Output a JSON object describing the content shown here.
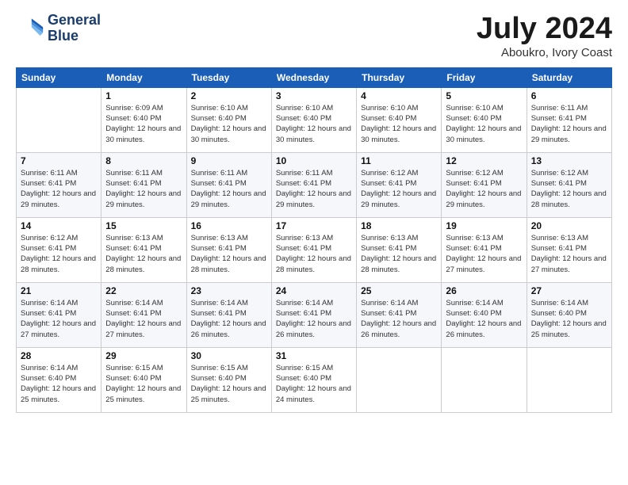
{
  "logo": {
    "line1": "General",
    "line2": "Blue"
  },
  "title": "July 2024",
  "subtitle": "Aboukro, Ivory Coast",
  "header": {
    "days": [
      "Sunday",
      "Monday",
      "Tuesday",
      "Wednesday",
      "Thursday",
      "Friday",
      "Saturday"
    ]
  },
  "weeks": [
    [
      {
        "num": "",
        "sunrise": "",
        "sunset": "",
        "daylight": ""
      },
      {
        "num": "1",
        "sunrise": "Sunrise: 6:09 AM",
        "sunset": "Sunset: 6:40 PM",
        "daylight": "Daylight: 12 hours and 30 minutes."
      },
      {
        "num": "2",
        "sunrise": "Sunrise: 6:10 AM",
        "sunset": "Sunset: 6:40 PM",
        "daylight": "Daylight: 12 hours and 30 minutes."
      },
      {
        "num": "3",
        "sunrise": "Sunrise: 6:10 AM",
        "sunset": "Sunset: 6:40 PM",
        "daylight": "Daylight: 12 hours and 30 minutes."
      },
      {
        "num": "4",
        "sunrise": "Sunrise: 6:10 AM",
        "sunset": "Sunset: 6:40 PM",
        "daylight": "Daylight: 12 hours and 30 minutes."
      },
      {
        "num": "5",
        "sunrise": "Sunrise: 6:10 AM",
        "sunset": "Sunset: 6:40 PM",
        "daylight": "Daylight: 12 hours and 30 minutes."
      },
      {
        "num": "6",
        "sunrise": "Sunrise: 6:11 AM",
        "sunset": "Sunset: 6:41 PM",
        "daylight": "Daylight: 12 hours and 29 minutes."
      }
    ],
    [
      {
        "num": "7",
        "sunrise": "Sunrise: 6:11 AM",
        "sunset": "Sunset: 6:41 PM",
        "daylight": "Daylight: 12 hours and 29 minutes."
      },
      {
        "num": "8",
        "sunrise": "Sunrise: 6:11 AM",
        "sunset": "Sunset: 6:41 PM",
        "daylight": "Daylight: 12 hours and 29 minutes."
      },
      {
        "num": "9",
        "sunrise": "Sunrise: 6:11 AM",
        "sunset": "Sunset: 6:41 PM",
        "daylight": "Daylight: 12 hours and 29 minutes."
      },
      {
        "num": "10",
        "sunrise": "Sunrise: 6:11 AM",
        "sunset": "Sunset: 6:41 PM",
        "daylight": "Daylight: 12 hours and 29 minutes."
      },
      {
        "num": "11",
        "sunrise": "Sunrise: 6:12 AM",
        "sunset": "Sunset: 6:41 PM",
        "daylight": "Daylight: 12 hours and 29 minutes."
      },
      {
        "num": "12",
        "sunrise": "Sunrise: 6:12 AM",
        "sunset": "Sunset: 6:41 PM",
        "daylight": "Daylight: 12 hours and 29 minutes."
      },
      {
        "num": "13",
        "sunrise": "Sunrise: 6:12 AM",
        "sunset": "Sunset: 6:41 PM",
        "daylight": "Daylight: 12 hours and 28 minutes."
      }
    ],
    [
      {
        "num": "14",
        "sunrise": "Sunrise: 6:12 AM",
        "sunset": "Sunset: 6:41 PM",
        "daylight": "Daylight: 12 hours and 28 minutes."
      },
      {
        "num": "15",
        "sunrise": "Sunrise: 6:13 AM",
        "sunset": "Sunset: 6:41 PM",
        "daylight": "Daylight: 12 hours and 28 minutes."
      },
      {
        "num": "16",
        "sunrise": "Sunrise: 6:13 AM",
        "sunset": "Sunset: 6:41 PM",
        "daylight": "Daylight: 12 hours and 28 minutes."
      },
      {
        "num": "17",
        "sunrise": "Sunrise: 6:13 AM",
        "sunset": "Sunset: 6:41 PM",
        "daylight": "Daylight: 12 hours and 28 minutes."
      },
      {
        "num": "18",
        "sunrise": "Sunrise: 6:13 AM",
        "sunset": "Sunset: 6:41 PM",
        "daylight": "Daylight: 12 hours and 28 minutes."
      },
      {
        "num": "19",
        "sunrise": "Sunrise: 6:13 AM",
        "sunset": "Sunset: 6:41 PM",
        "daylight": "Daylight: 12 hours and 27 minutes."
      },
      {
        "num": "20",
        "sunrise": "Sunrise: 6:13 AM",
        "sunset": "Sunset: 6:41 PM",
        "daylight": "Daylight: 12 hours and 27 minutes."
      }
    ],
    [
      {
        "num": "21",
        "sunrise": "Sunrise: 6:14 AM",
        "sunset": "Sunset: 6:41 PM",
        "daylight": "Daylight: 12 hours and 27 minutes."
      },
      {
        "num": "22",
        "sunrise": "Sunrise: 6:14 AM",
        "sunset": "Sunset: 6:41 PM",
        "daylight": "Daylight: 12 hours and 27 minutes."
      },
      {
        "num": "23",
        "sunrise": "Sunrise: 6:14 AM",
        "sunset": "Sunset: 6:41 PM",
        "daylight": "Daylight: 12 hours and 26 minutes."
      },
      {
        "num": "24",
        "sunrise": "Sunrise: 6:14 AM",
        "sunset": "Sunset: 6:41 PM",
        "daylight": "Daylight: 12 hours and 26 minutes."
      },
      {
        "num": "25",
        "sunrise": "Sunrise: 6:14 AM",
        "sunset": "Sunset: 6:41 PM",
        "daylight": "Daylight: 12 hours and 26 minutes."
      },
      {
        "num": "26",
        "sunrise": "Sunrise: 6:14 AM",
        "sunset": "Sunset: 6:40 PM",
        "daylight": "Daylight: 12 hours and 26 minutes."
      },
      {
        "num": "27",
        "sunrise": "Sunrise: 6:14 AM",
        "sunset": "Sunset: 6:40 PM",
        "daylight": "Daylight: 12 hours and 25 minutes."
      }
    ],
    [
      {
        "num": "28",
        "sunrise": "Sunrise: 6:14 AM",
        "sunset": "Sunset: 6:40 PM",
        "daylight": "Daylight: 12 hours and 25 minutes."
      },
      {
        "num": "29",
        "sunrise": "Sunrise: 6:15 AM",
        "sunset": "Sunset: 6:40 PM",
        "daylight": "Daylight: 12 hours and 25 minutes."
      },
      {
        "num": "30",
        "sunrise": "Sunrise: 6:15 AM",
        "sunset": "Sunset: 6:40 PM",
        "daylight": "Daylight: 12 hours and 25 minutes."
      },
      {
        "num": "31",
        "sunrise": "Sunrise: 6:15 AM",
        "sunset": "Sunset: 6:40 PM",
        "daylight": "Daylight: 12 hours and 24 minutes."
      },
      {
        "num": "",
        "sunrise": "",
        "sunset": "",
        "daylight": ""
      },
      {
        "num": "",
        "sunrise": "",
        "sunset": "",
        "daylight": ""
      },
      {
        "num": "",
        "sunrise": "",
        "sunset": "",
        "daylight": ""
      }
    ]
  ]
}
